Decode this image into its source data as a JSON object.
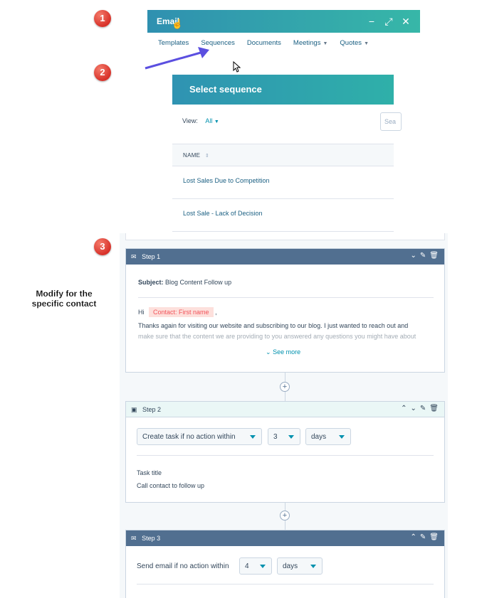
{
  "badges": [
    "1",
    "2",
    "3"
  ],
  "email": {
    "title": "Email",
    "controls": {
      "minimize": "−",
      "expand": "⤢",
      "close": "✕"
    },
    "nav": [
      {
        "label": "Templates",
        "dropdown": false
      },
      {
        "label": "Sequences",
        "dropdown": false
      },
      {
        "label": "Documents",
        "dropdown": false
      },
      {
        "label": "Meetings",
        "dropdown": true
      },
      {
        "label": "Quotes",
        "dropdown": true
      }
    ]
  },
  "sequence_picker": {
    "title": "Select sequence",
    "view_label": "View:",
    "view_value": "All",
    "search_placeholder": "Sea",
    "column_header": "NAME",
    "rows": [
      "Lost Sales Due to Competition",
      "Lost Sale - Lack of Decision"
    ]
  },
  "note": "Modify for the specific contact",
  "steps": {
    "step1": {
      "label": "Step 1",
      "subject_label": "Subject:",
      "subject_value": "Blog Content Follow up",
      "greeting": "Hi",
      "token": "Contact: First name",
      "comma": ",",
      "body_line1": "Thanks again for visiting our website and subscribing to our blog.  I just wanted to reach out and",
      "body_line2": "make sure that the content we are providing to you answered any questions you might have about",
      "see_more": "See more"
    },
    "step2": {
      "label": "Step 2",
      "action": "Create task if no action within",
      "count": "3",
      "unit": "days",
      "task_title_label": "Task title",
      "task_title_value": "Call contact to follow up"
    },
    "step3": {
      "label": "Step 3",
      "action": "Send email if no action within",
      "count": "4",
      "unit": "days"
    }
  },
  "colors": {
    "header_gradient_start": "#2f90b0",
    "header_gradient_end": "#37b7a8",
    "step_dark": "#516f90",
    "link": "#0091ae",
    "token_bg": "#fde0dc",
    "token_text": "#f2545b",
    "arrow": "#5b4fe0",
    "badge": "#d8322a"
  }
}
